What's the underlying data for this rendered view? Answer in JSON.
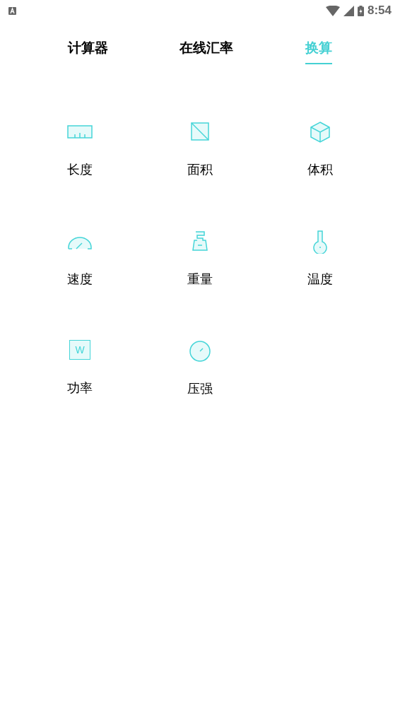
{
  "status_bar": {
    "time": "8:54"
  },
  "tabs": [
    {
      "label": "计算器",
      "selected": false
    },
    {
      "label": "在线汇率",
      "selected": false
    },
    {
      "label": "换算",
      "selected": true
    }
  ],
  "converters": [
    {
      "kind": "ruler",
      "label": "长度"
    },
    {
      "kind": "square",
      "label": "面积"
    },
    {
      "kind": "cube",
      "label": "体积"
    },
    {
      "kind": "gauge",
      "label": "速度"
    },
    {
      "kind": "weight",
      "label": "重量"
    },
    {
      "kind": "flask",
      "label": "温度"
    },
    {
      "kind": "watt",
      "label": "功率",
      "icon_text": "W"
    },
    {
      "kind": "dial",
      "label": "压强"
    }
  ]
}
